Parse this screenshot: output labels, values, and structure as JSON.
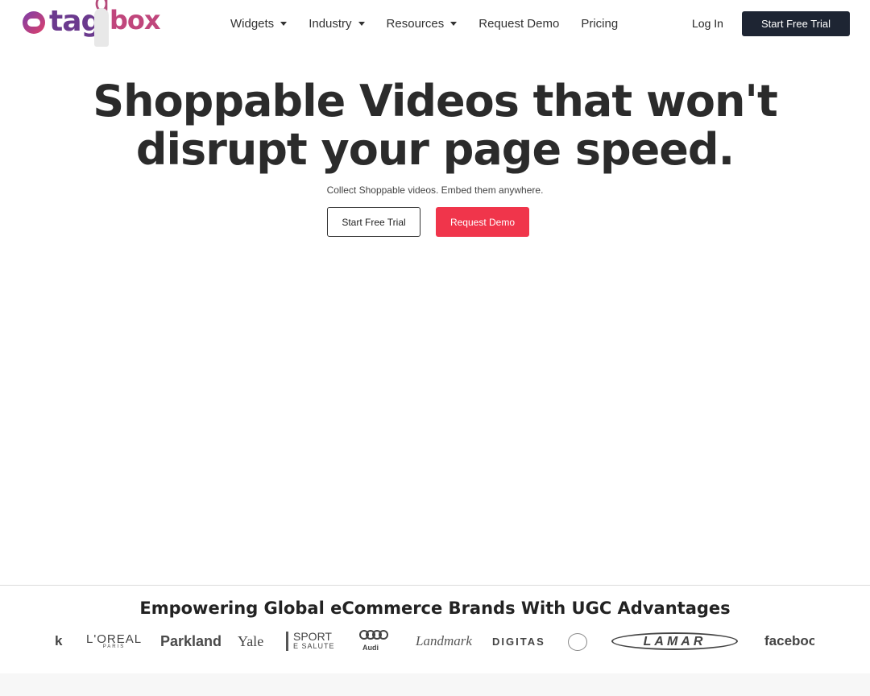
{
  "brand": {
    "logo_word_left": "tag",
    "logo_word_right": "box",
    "logo_g": "g"
  },
  "nav": {
    "items": [
      {
        "label": "Widgets",
        "has_dropdown": true
      },
      {
        "label": "Industry",
        "has_dropdown": true
      },
      {
        "label": "Resources",
        "has_dropdown": true
      },
      {
        "label": "Request Demo",
        "has_dropdown": false
      },
      {
        "label": "Pricing",
        "has_dropdown": false
      }
    ],
    "login_label": "Log In",
    "cta_label": "Start Free Trial"
  },
  "hero": {
    "title_line1": "Shoppable Videos that won't",
    "title_line2": "disrupt your page speed.",
    "subtitle": "Collect Shoppable videos. Embed them anywhere.",
    "primary_button": "Start Free Trial",
    "secondary_button": "Request Demo"
  },
  "brands": {
    "title": "Empowering Global eCommerce Brands With UGC Advantages",
    "logos": {
      "facebook_partial_left": "k",
      "loreal": "L'OREAL",
      "loreal_sub": "PARIS",
      "parkland": "Parkland",
      "yale": "Yale",
      "sport": "SPORT",
      "sport_sub": "E SALUTE",
      "audi": "Audi",
      "landmark": "Landmark",
      "digitas": "DIGITAS",
      "lamar": "LAMAR",
      "facebook_partial_right": "faceboo"
    }
  },
  "colors": {
    "cta_dark": "#1e2533",
    "cta_red": "#f0354b",
    "logo_purple": "#6b3a8e",
    "logo_pink": "#c0467c"
  }
}
